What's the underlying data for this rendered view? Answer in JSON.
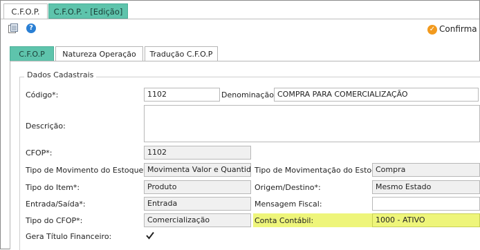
{
  "top_tabs": [
    "C.F.O.P.",
    "C.F.O.P. - [Edição]"
  ],
  "toolbar": {
    "confirm_label": "Confirma",
    "help_symbol": "?"
  },
  "inner_tabs": [
    "C.F.O.P",
    "Natureza Operação",
    "Tradução C.F.O.P"
  ],
  "group_title": "Dados Cadastrais",
  "fields": {
    "codigo_label": "Código*:",
    "codigo_value": "1102",
    "denominacao_label": "Denominação*:",
    "denominacao_value": "COMPRA PARA COMERCIALIZAÇÃO",
    "descricao_label": "Descrição:",
    "descricao_value": "",
    "cfop_label": "CFOP*:",
    "cfop_value": "1102",
    "tipo_mov_estoque_label": "Tipo de Movimento do Estoque*:",
    "tipo_mov_estoque_value": "Movimenta Valor e Quantidade",
    "tipo_movimentacao_label": "Tipo de Movimentação do Estoque*:",
    "tipo_movimentacao_value": "Compra",
    "tipo_item_label": "Tipo do Item*:",
    "tipo_item_value": "Produto",
    "origem_destino_label": "Origem/Destino*:",
    "origem_destino_value": "Mesmo Estado",
    "entrada_saida_label": "Entrada/Saída*:",
    "entrada_saida_value": "Entrada",
    "mensagem_fiscal_label": "Mensagem Fiscal:",
    "mensagem_fiscal_value": "",
    "tipo_cfop_label": "Tipo do CFOP*:",
    "tipo_cfop_value": "Comercialização",
    "conta_contabil_label": "Conta Contábil:",
    "conta_contabil_value": "1000 - ATIVO",
    "gera_titulo_label": "Gera Título Financeiro:",
    "gera_titulo_checked": true
  },
  "colors": {
    "accent_tab": "#5ec4ac",
    "highlight": "#eef57a",
    "confirm_icon": "#f29a1e",
    "help_icon": "#2a7fd4"
  }
}
